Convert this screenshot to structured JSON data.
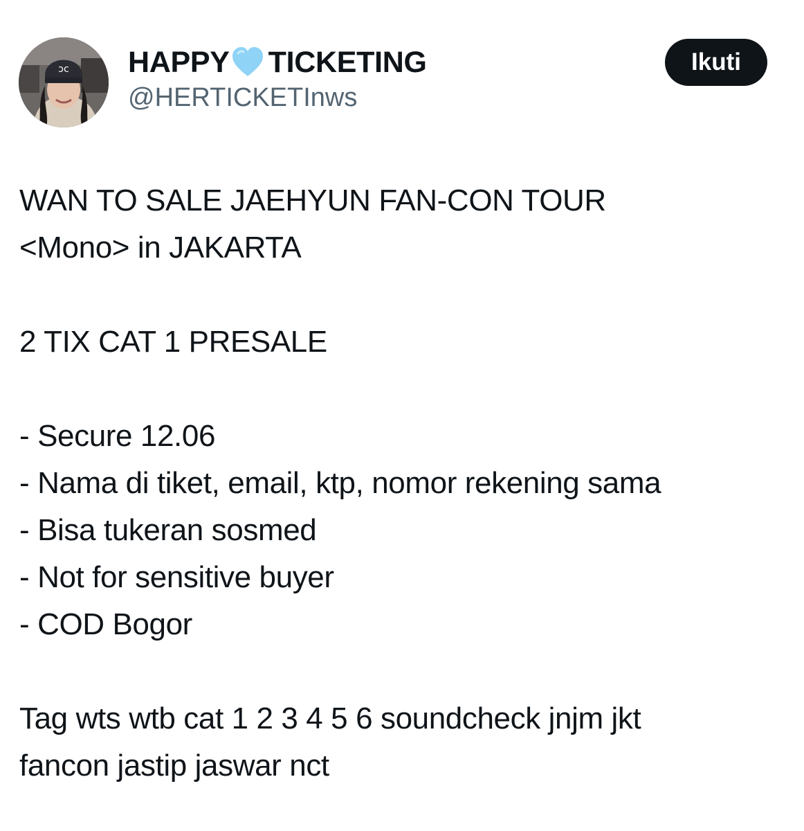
{
  "post": {
    "author": {
      "name_part1": "HAPPY",
      "heart_icon": "light-blue-heart-emoji",
      "name_part2": "TICKETING",
      "handle": "@HERTICKETInws",
      "avatar_icon": "profile-photo"
    },
    "follow_label": "Ikuti",
    "body": {
      "title_line1": "WAN TO SALE JAEHYUN FAN-CON TOUR",
      "title_line2": "<Mono> in JAKARTA",
      "ticket_line": "2 TIX CAT 1 PRESALE",
      "bullets": [
        "- Secure 12.06",
        "- Nama di tiket, email, ktp, nomor rekening sama",
        "- Bisa tukeran sosmed",
        "- Not for sensitive buyer",
        "- COD Bogor"
      ],
      "tags_line1": "Tag wts wtb cat 1 2 3 4 5 6 soundcheck jnjm jkt",
      "tags_line2": "fancon jastip jaswar nct"
    }
  },
  "colors": {
    "text": "#0f1419",
    "secondary_text": "#536471",
    "button_bg": "#0f1419",
    "button_text": "#ffffff",
    "heart": "#8fd3f6"
  }
}
